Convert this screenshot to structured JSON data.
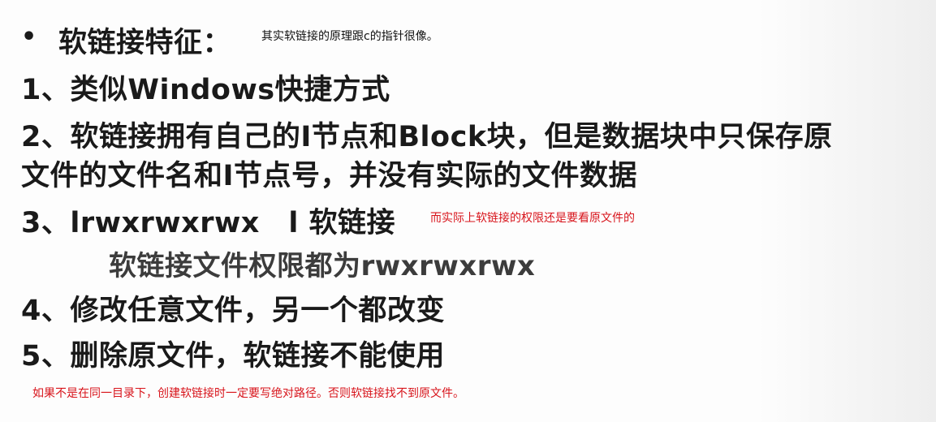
{
  "heading": {
    "bullet": "•",
    "title": "软链接特征：",
    "note": "其实软链接的原理跟c的指针很像。"
  },
  "items": {
    "item1": "1、类似Windows快捷方式",
    "item2_line1": "2、软链接拥有自己的I节点和Block块，但是数据块中只保存原",
    "item2_line2": "文件的文件名和I节点号，并没有实际的文件数据",
    "item3_main": "3、lrwxrwxrwx　l 软链接",
    "item3_note": "而实际上软链接的权限还是要看原文件的",
    "item3_sub": "软链接文件权限都为rwxrwxrwx",
    "item4": "4、修改任意文件，另一个都改变",
    "item5": "5、删除原文件，软链接不能使用"
  },
  "footer_note": "如果不是在同一目录下，创建软链接时一定要写绝对路径。否则软链接找不到原文件。",
  "colors": {
    "text": "#1a1a1a",
    "sub_text": "#3c3c3c",
    "note_red": "#d8141b",
    "background": "#fdfdfd"
  }
}
